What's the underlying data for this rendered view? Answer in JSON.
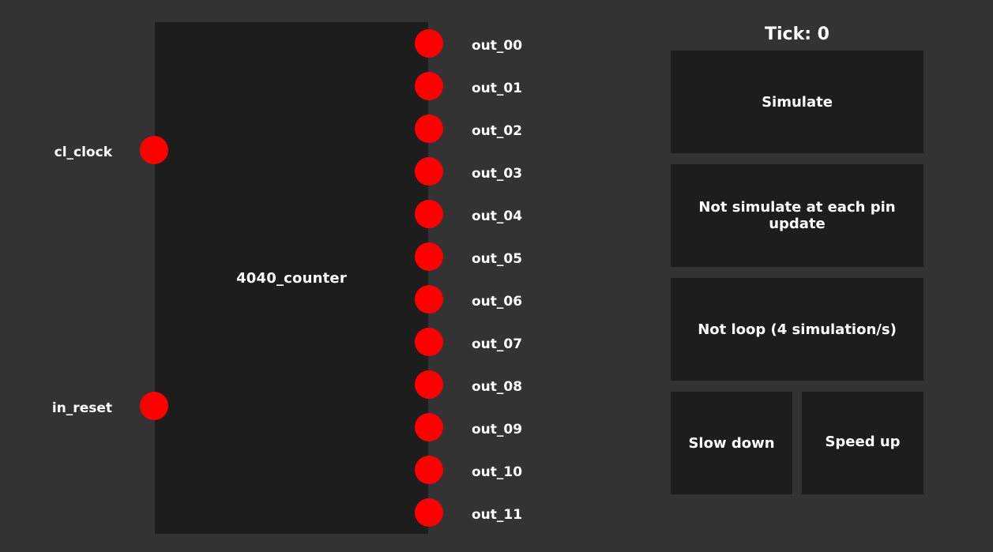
{
  "chip": {
    "name": "4040_counter",
    "pin_color": "#ff0000",
    "inputs": [
      {
        "label": "cl_clock"
      },
      {
        "label": "in_reset"
      }
    ],
    "outputs": [
      {
        "label": "out_00"
      },
      {
        "label": "out_01"
      },
      {
        "label": "out_02"
      },
      {
        "label": "out_03"
      },
      {
        "label": "out_04"
      },
      {
        "label": "out_05"
      },
      {
        "label": "out_06"
      },
      {
        "label": "out_07"
      },
      {
        "label": "out_08"
      },
      {
        "label": "out_09"
      },
      {
        "label": "out_10"
      },
      {
        "label": "out_11"
      }
    ]
  },
  "controls": {
    "tick": "Tick: 0",
    "simulate_label": "Simulate",
    "pin_update_label": "Not simulate at each pin update",
    "loop_label": "Not loop (4 simulation/s)",
    "slow_down_label": "Slow down",
    "speed_up_label": "Speed up"
  },
  "colors": {
    "background": "#333333",
    "panel": "#1d1d1d",
    "text": "#ffffff",
    "pin": "#ff0000"
  }
}
